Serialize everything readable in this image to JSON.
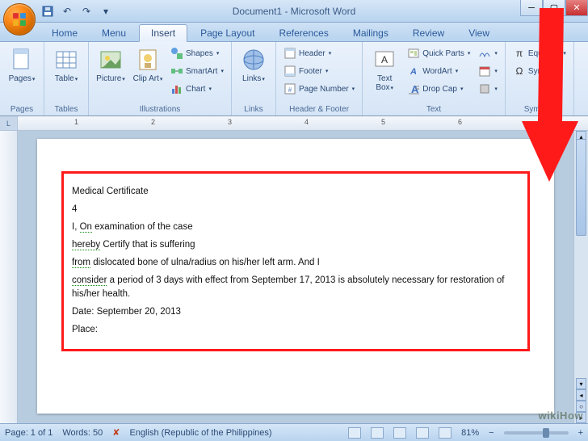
{
  "app": {
    "title": "Document1 - Microsoft Word"
  },
  "qat": {
    "save_tip": "Save",
    "undo_tip": "Undo",
    "redo_tip": "Redo"
  },
  "tabs": [
    "Home",
    "Menu",
    "Insert",
    "Page Layout",
    "References",
    "Mailings",
    "Review",
    "View"
  ],
  "active_tab": 2,
  "ribbon": {
    "groups": [
      {
        "label": "Pages",
        "big": [
          {
            "name": "pages-button",
            "label": "Pages",
            "icon": "page"
          }
        ]
      },
      {
        "label": "Tables",
        "big": [
          {
            "name": "table-button",
            "label": "Table",
            "icon": "table"
          }
        ]
      },
      {
        "label": "Illustrations",
        "big": [
          {
            "name": "picture-button",
            "label": "Picture",
            "icon": "picture"
          },
          {
            "name": "clipart-button",
            "label": "Clip Art",
            "icon": "clipart"
          }
        ],
        "small": [
          {
            "name": "shapes-button",
            "label": "Shapes",
            "icon": "shapes"
          },
          {
            "name": "smartart-button",
            "label": "SmartArt",
            "icon": "smartart"
          },
          {
            "name": "chart-button",
            "label": "Chart",
            "icon": "chart"
          }
        ]
      },
      {
        "label": "Links",
        "big": [
          {
            "name": "links-button",
            "label": "Links",
            "icon": "link"
          }
        ]
      },
      {
        "label": "Header & Footer",
        "small": [
          {
            "name": "header-button",
            "label": "Header",
            "icon": "header"
          },
          {
            "name": "footer-button",
            "label": "Footer",
            "icon": "footer"
          },
          {
            "name": "pagenumber-button",
            "label": "Page Number",
            "icon": "pagenum"
          }
        ]
      },
      {
        "label": "Text",
        "big": [
          {
            "name": "textbox-button",
            "label": "Text Box",
            "icon": "textbox"
          }
        ],
        "small": [
          {
            "name": "quickparts-button",
            "label": "Quick Parts",
            "icon": "quickparts"
          },
          {
            "name": "wordart-button",
            "label": "WordArt",
            "icon": "wordart"
          },
          {
            "name": "dropcap-button",
            "label": "Drop Cap",
            "icon": "dropcap"
          }
        ],
        "tiny": [
          {
            "name": "signature-button",
            "icon": "sig"
          },
          {
            "name": "datetime-button",
            "icon": "date"
          },
          {
            "name": "object-button",
            "icon": "obj"
          }
        ]
      },
      {
        "label": "Symbols",
        "small": [
          {
            "name": "equation-button",
            "label": "Equation",
            "icon": "equation"
          },
          {
            "name": "symbol-button",
            "label": "Symbol",
            "icon": "symbol"
          }
        ]
      }
    ]
  },
  "ruler": {
    "marks": [
      "1",
      "2",
      "3",
      "4",
      "5",
      "6"
    ]
  },
  "document": {
    "lines": [
      {
        "t": "Medical Certificate"
      },
      {
        "t": "4"
      },
      {
        "t": "I, ",
        "sq": "On",
        "rest": " examination of the case"
      },
      {
        "sq": "hereby",
        "rest": " Certify that is suffering"
      },
      {
        "sq": "from",
        "rest": " dislocated bone of ulna/radius on his/her left arm. And I"
      },
      {
        "sq": "consider",
        "rest": " a period of 3 days with effect from September 17, 2013 is absolutely necessary for restoration of his/her health."
      },
      {
        "t": "Date: September 20, 2013"
      },
      {
        "t": "Place:"
      }
    ]
  },
  "statusbar": {
    "page": "Page: 1 of 1",
    "words": "Words: 50",
    "language": "English (Republic of the Philippines)",
    "zoom": "81%"
  },
  "watermark": "wikiHow"
}
